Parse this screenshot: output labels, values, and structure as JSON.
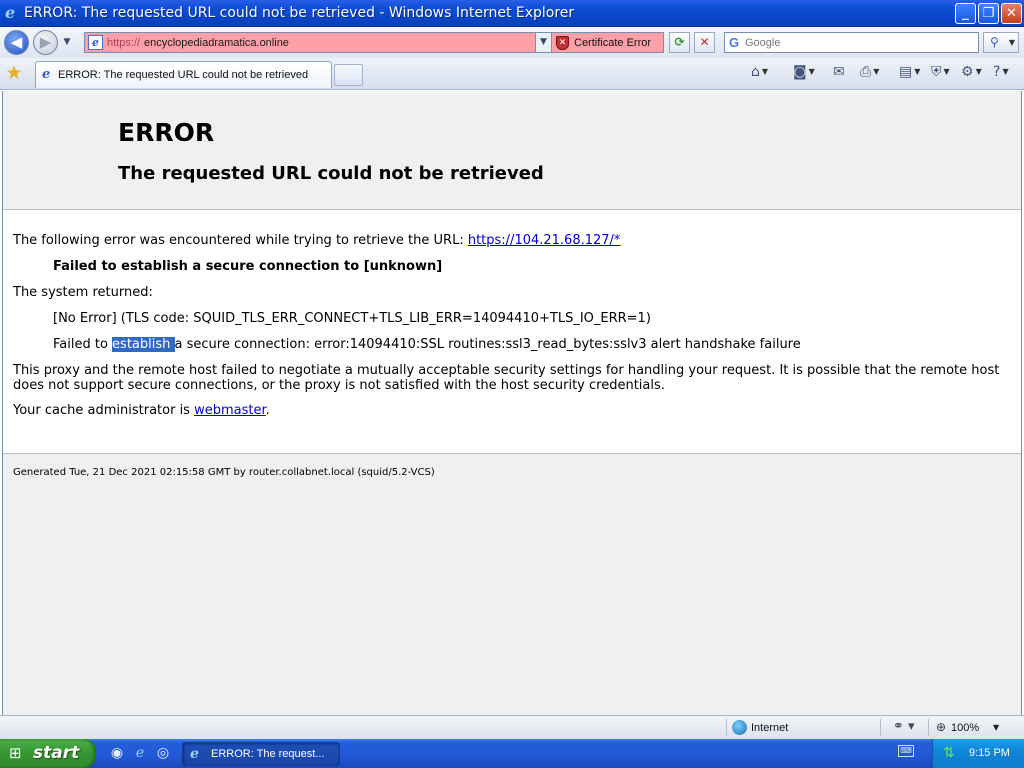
{
  "window": {
    "title": "ERROR: The requested URL could not be retrieved - Windows Internet Explorer",
    "app_icon": "ie-icon",
    "controls": [
      "minimize",
      "maximize",
      "close"
    ]
  },
  "navbar": {
    "address": {
      "scheme": "https://",
      "host": "encyclopediadramatica.online",
      "background": "#ff9fa8"
    },
    "certificate_label": "Certificate Error",
    "search_placeholder": "Google"
  },
  "tabs": [
    {
      "label": "ERROR: The requested URL could not be retrieved",
      "active": true
    }
  ],
  "page": {
    "h1": "ERROR",
    "h2": "The requested URL could not be retrieved",
    "intro": "The following error was encountered while trying to retrieve the URL: ",
    "url_link": "https://104.21.68.127/*",
    "failed_secure": "Failed to establish a secure connection to [unknown]",
    "system_returned": "The system returned:",
    "no_error_line": "[No Error] (TLS code: SQUID_TLS_ERR_CONNECT+TLS_LIB_ERR=14094410+TLS_IO_ERR=1)",
    "failed_prefix": "Failed to ",
    "failed_selected": "establish ",
    "failed_suffix": "a secure connection: error:14094410:SSL routines:ssl3_read_bytes:sslv3 alert handshake failure",
    "explanation": "This proxy and the remote host failed to negotiate a mutually acceptable security settings for handling your request. It is possible that the remote host does not support secure connections, or the proxy is not satisfied with the host security credentials.",
    "admin_prefix": "Your cache administrator is ",
    "admin_link": "webmaster",
    "admin_suffix": ".",
    "generated": "Generated Tue, 21 Dec 2021 02:15:58 GMT by router.collabnet.local (squid/5.2-VCS)"
  },
  "statusbar": {
    "zone": "Internet",
    "zoom": "100%"
  },
  "taskbar": {
    "start_label": "start",
    "task_label": "ERROR: The request...",
    "clock": "9:15 PM"
  },
  "colors": {
    "link": "#0000cc",
    "selection": "#316ac5",
    "error_bar": "#ff9fa8"
  }
}
